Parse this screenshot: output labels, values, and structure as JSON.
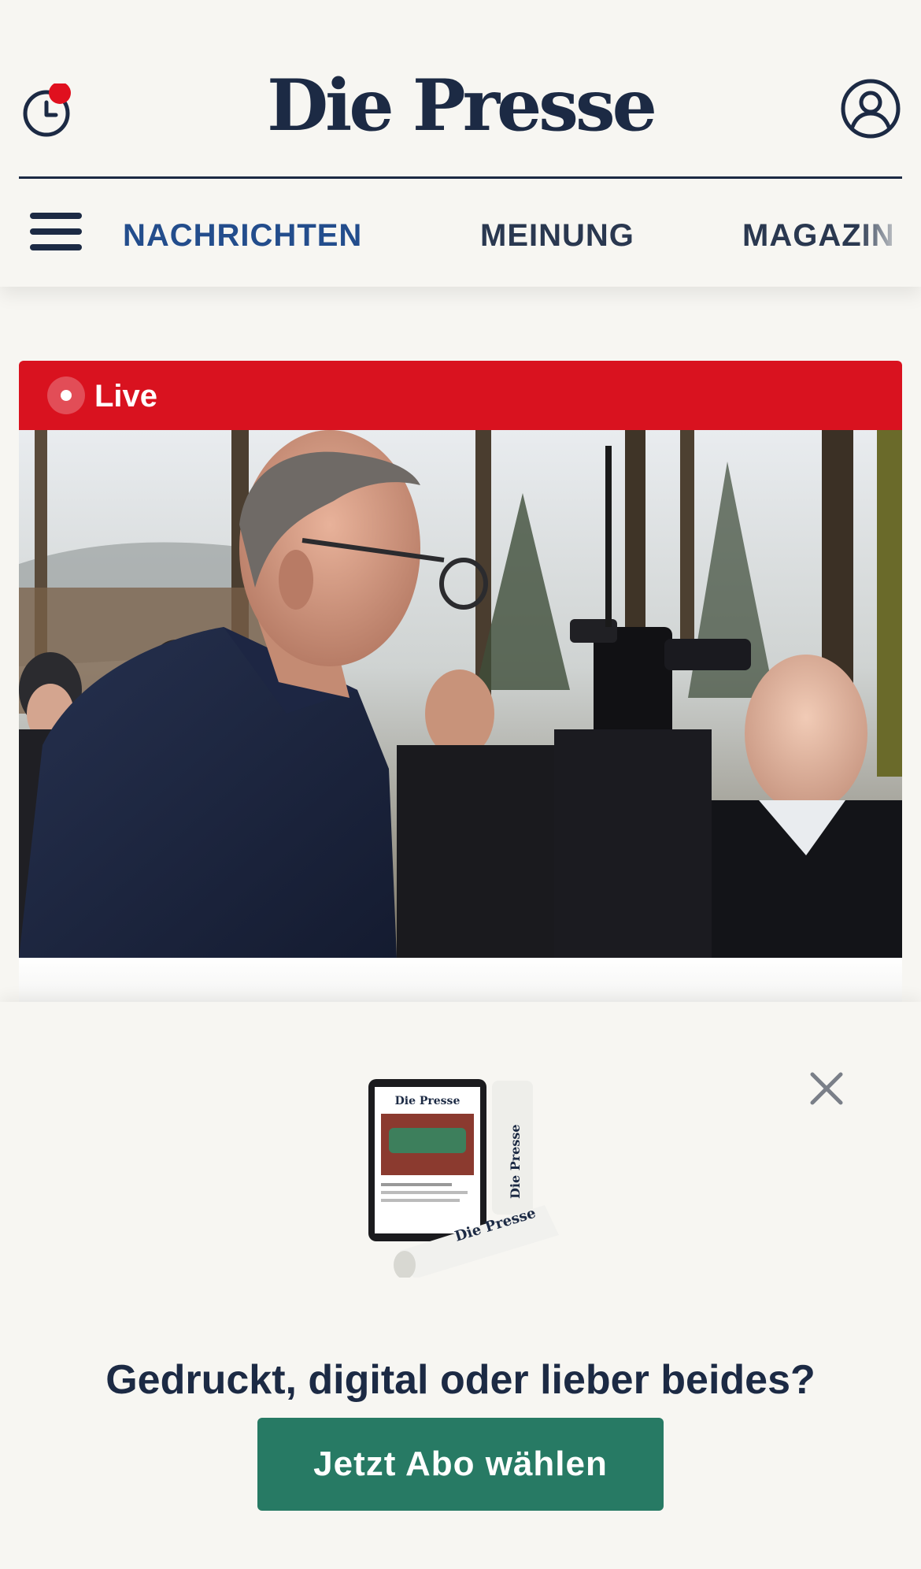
{
  "header": {
    "logo_text": "Die Presse",
    "notification_dot_color": "#e0101e",
    "nav_tabs": [
      {
        "label": "NACHRICHTEN",
        "active": true
      },
      {
        "label": "MEINUNG",
        "active": false
      },
      {
        "label": "MAGAZIN",
        "active": false
      }
    ]
  },
  "article": {
    "live_label": "Live",
    "image_description_icon": "photo"
  },
  "promo": {
    "headline": "Gedruckt, digital oder lieber beides?",
    "cta_label": "Jetzt Abo wählen",
    "art_logo_text": "Die Presse",
    "close_icon": "close-icon"
  },
  "colors": {
    "brand_navy": "#1c2a44",
    "nav_active": "#234d8c",
    "live_red": "#d9121f",
    "cta_green": "#277a64",
    "background": "#f7f6f2"
  }
}
